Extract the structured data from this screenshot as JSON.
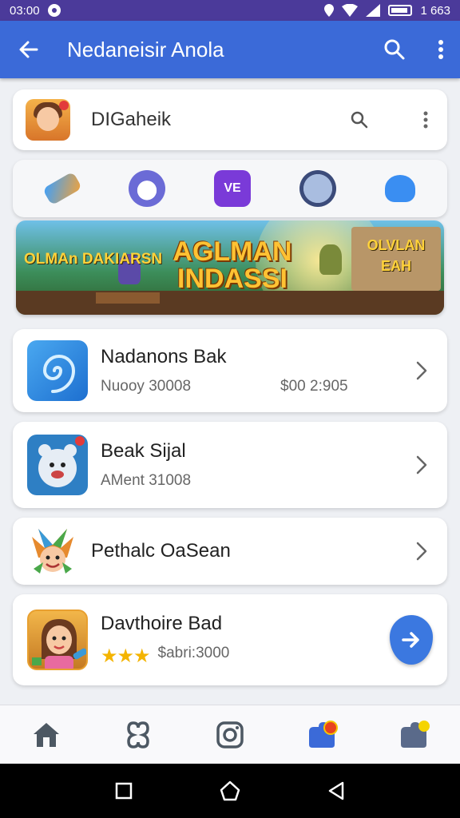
{
  "status_bar": {
    "time": "03:00",
    "clock": "1 663"
  },
  "app_bar": {
    "title": "Nedaneisir Anola"
  },
  "profile": {
    "name": "DIGaheik"
  },
  "categories": [
    {
      "icon": "pencil-toy-icon"
    },
    {
      "icon": "creature-face-icon"
    },
    {
      "icon": "ve-badge-icon",
      "label": "VE"
    },
    {
      "icon": "robot-head-icon"
    },
    {
      "icon": "ghost-icon"
    }
  ],
  "banner": {
    "left_text": "OLMAn DAKIARSN",
    "main_text": "AGLMAN INDASSI",
    "right_text": "OLVLAN EAH"
  },
  "list": [
    {
      "name": "Nadanons Bak",
      "meta_left": "Nuooy 30008",
      "meta_right": "$00 2:905"
    },
    {
      "name": "Beak Sijal",
      "meta_left": "AMent 31008"
    },
    {
      "name": "Pethalc OaSean"
    },
    {
      "name": "Davthoire Bad",
      "rating": 3,
      "meta": "$abri:3000"
    }
  ],
  "bottom_nav": [
    {
      "icon": "home-icon"
    },
    {
      "icon": "connections-icon"
    },
    {
      "icon": "camera-icon"
    },
    {
      "icon": "puzzle-alert-icon"
    },
    {
      "icon": "puzzle-icon"
    }
  ],
  "colors": {
    "status_bar": "#4b3a9a",
    "app_bar": "#3b6ad8",
    "accent": "#3b78e0",
    "star": "#f4b400"
  }
}
